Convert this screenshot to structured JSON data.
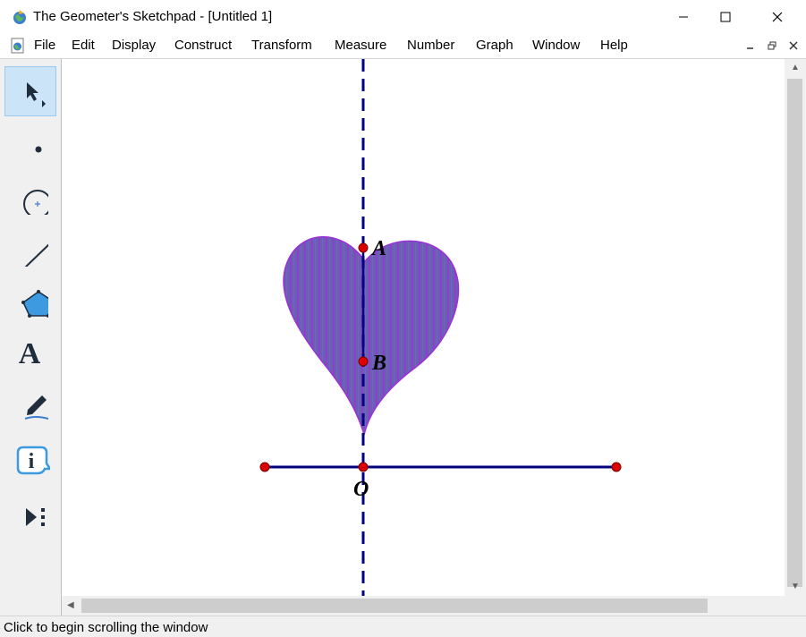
{
  "window": {
    "title": "The Geometer's Sketchpad - [Untitled 1]",
    "app_icon": "sketchpad-globe-icon",
    "controls": [
      "minimize-icon",
      "maximize-icon",
      "close-icon"
    ]
  },
  "menu": {
    "items": [
      "File",
      "Edit",
      "Display",
      "Construct",
      "Transform",
      "Measure",
      "Number",
      "Graph",
      "Window",
      "Help"
    ],
    "mdi_controls": [
      "mdi-minimize-icon",
      "mdi-restore-icon",
      "mdi-close-icon"
    ]
  },
  "toolbox": {
    "tools": [
      {
        "name": "selection-arrow-tool",
        "icon": "arrow-icon",
        "selected": true
      },
      {
        "name": "point-tool",
        "icon": "point-icon"
      },
      {
        "name": "compass-tool",
        "icon": "circle-icon"
      },
      {
        "name": "straightedge-tool",
        "icon": "segment-icon"
      },
      {
        "name": "polygon-tool",
        "icon": "pentagon-icon"
      },
      {
        "name": "text-tool",
        "icon": "letter-a-icon",
        "label": "A"
      },
      {
        "name": "marker-tool",
        "icon": "marker-pen-icon"
      },
      {
        "name": "information-tool",
        "icon": "info-icon",
        "label": "i"
      },
      {
        "name": "custom-tool",
        "icon": "play-menu-icon"
      }
    ]
  },
  "canvas": {
    "points": [
      {
        "label": "A"
      },
      {
        "label": "B"
      },
      {
        "label": "O"
      }
    ],
    "colors": {
      "line": "#00007f",
      "point": "#dd0000",
      "heart_fill": "#6b5fb5",
      "heart_stripe": "#9b30d6"
    }
  },
  "status": {
    "text": "Click to begin scrolling the window"
  }
}
